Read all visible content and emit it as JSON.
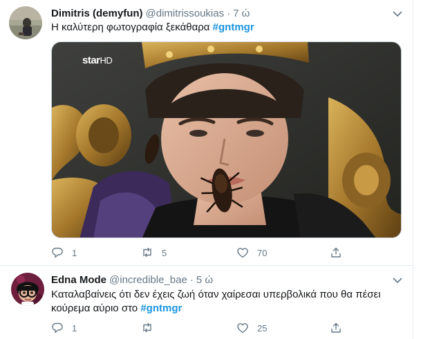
{
  "tweets": [
    {
      "display_name": "Dimitris (demyfun)",
      "handle": "@dimitrissoukias",
      "separator": "·",
      "time": "7 ώ",
      "text": "Η καλύτερη φωτογραφία ξεκάθαρα",
      "hashtag": "#gntmgr",
      "media": {
        "channel_logo": "star",
        "channel_logo_suffix": "HD"
      },
      "actions": {
        "reply_count": "1",
        "retweet_count": "5",
        "like_count": "70"
      }
    },
    {
      "display_name": "Edna Mode",
      "handle": "@incredible_bae",
      "separator": "·",
      "time": "5 ώ",
      "text": "Καταλαβαίνεις ότι δεν έχεις ζωή όταν χαίρεσαι υπερβολικά που θα πέσει κούρεμα αύριο στο",
      "hashtag": "#gntmgr",
      "actions": {
        "reply_count": "1",
        "retweet_count": "",
        "like_count": "25"
      }
    }
  ],
  "icons": {
    "reply": "reply-icon",
    "retweet": "retweet-icon",
    "like": "heart-icon",
    "share": "share-icon",
    "more": "chevron-down-icon"
  },
  "colors": {
    "link": "#1b95e0",
    "secondary_text": "#657786",
    "divider": "#e6ecf0"
  }
}
